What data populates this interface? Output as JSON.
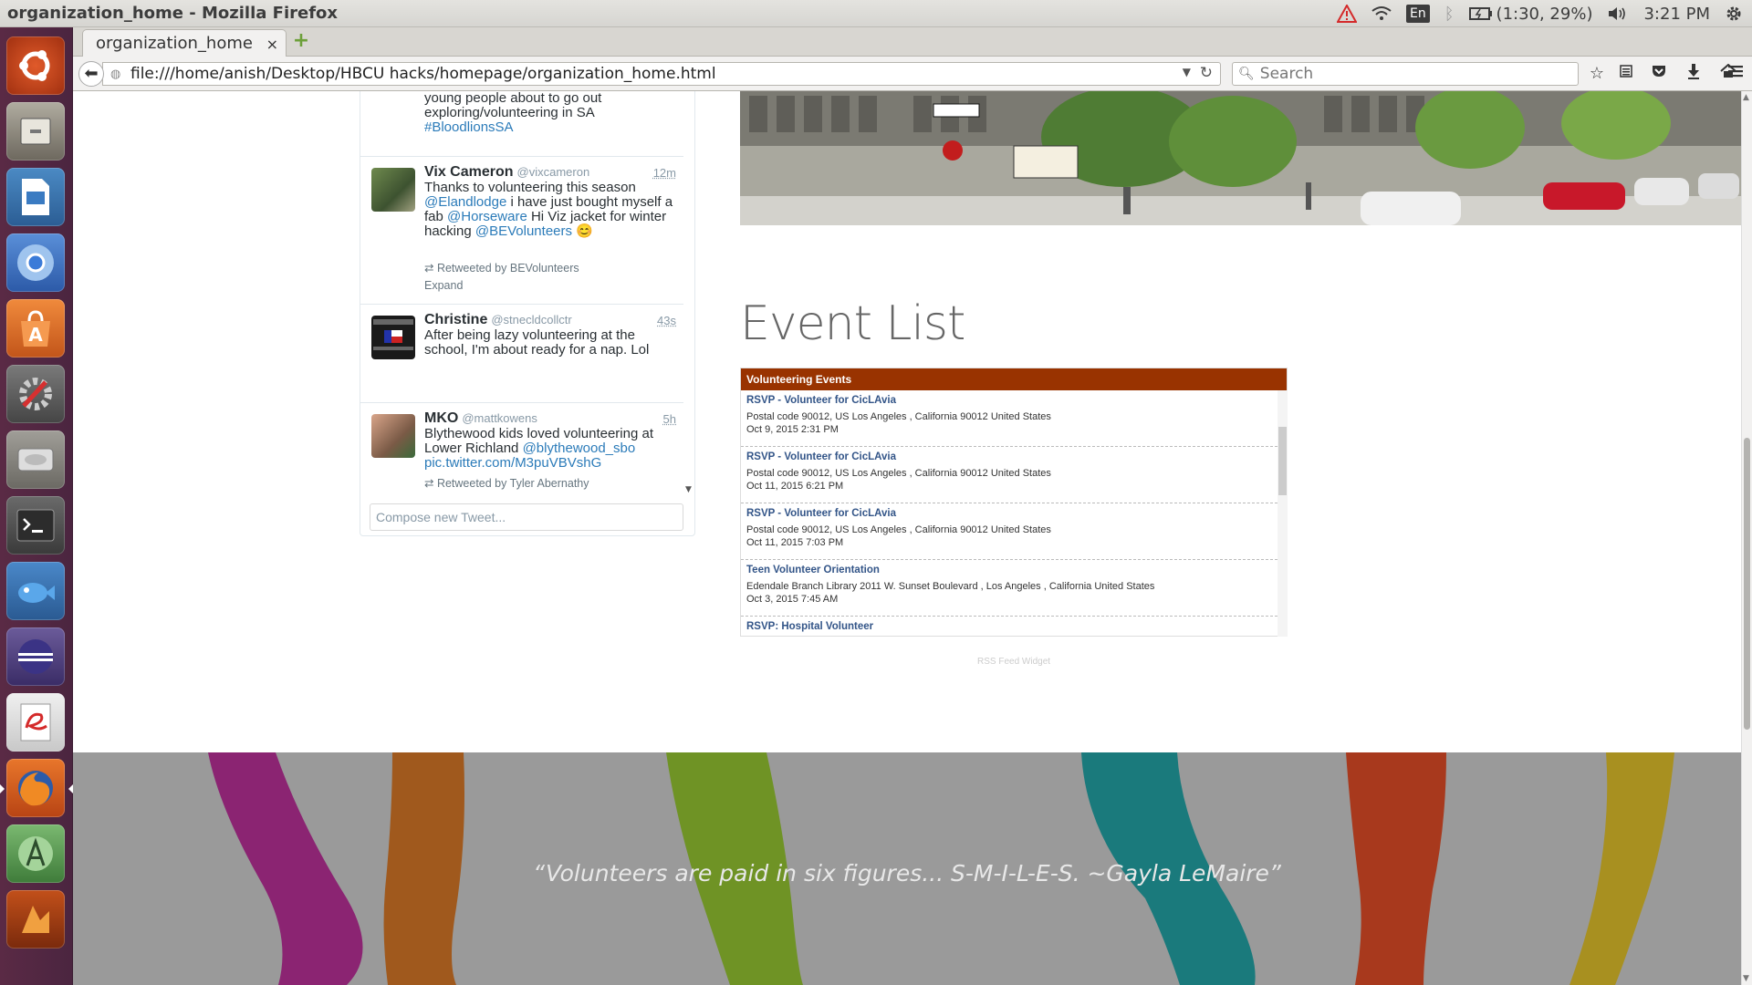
{
  "window": {
    "title": "organization_home - Mozilla Firefox"
  },
  "panel": {
    "battery": "(1:30, 29%)",
    "clock": "3:21 PM",
    "lang": "En"
  },
  "launcher": {
    "items": [
      "Ubuntu dash",
      "Files",
      "LibreOffice Impress",
      "Chromium",
      "Ubuntu Software Center",
      "System Settings",
      "Disk",
      "Terminal",
      "Mail client",
      "Eclipse",
      "Evince",
      "Firefox",
      "Android Studio",
      "Other app"
    ]
  },
  "browser": {
    "tab_title": "organization_home",
    "tab_close": "×",
    "new_tab": "+",
    "url": "file:///home/anish/Desktop/HBCU hacks/homepage/organization_home.html",
    "search_placeholder": "Search"
  },
  "twitter": {
    "tweets": [
      {
        "name": "",
        "handle": "",
        "time": "",
        "text_prefix": "young people about to go out exploring/volunteering in SA",
        "hashtag": "#BloodlionsSA"
      },
      {
        "name": "Vix Cameron",
        "handle": "@vixcameron",
        "time": "12m",
        "text_1": "Thanks to volunteering this season",
        "mention_1": "@Elandlodge",
        "text_2": "i have just bought myself a fab",
        "mention_2": "@Horseware",
        "text_3": "Hi Viz jacket for winter hacking",
        "mention_3": "@BEVolunteers",
        "emoji": "😊",
        "retweeted_by": "Retweeted by BEVolunteers",
        "expand": "Expand"
      },
      {
        "name": "Christine",
        "handle": "@stnecldcollctr",
        "time": "43s",
        "text": "After being lazy volunteering at the school, I'm about ready for a nap. Lol"
      },
      {
        "name": "MKO",
        "handle": "@mattkowens",
        "time": "5h",
        "text_1": "Blythewood kids loved volunteering at Lower Richland",
        "mention_1": "@blythewood_sbo",
        "link": "pic.twitter.com/M3puVBVshG",
        "retweeted_by": "Retweeted by Tyler Abernathy"
      }
    ],
    "compose_placeholder": "Compose new Tweet..."
  },
  "event_list": {
    "title": "Event List",
    "widget_header": "Volunteering Events",
    "items": [
      {
        "title": "RSVP - Volunteer for CicLAvia",
        "location": "Postal code 90012, US Los Angeles , California 90012 United States",
        "date": "Oct 9, 2015 2:31 PM"
      },
      {
        "title": "RSVP - Volunteer for CicLAvia",
        "location": "Postal code 90012, US Los Angeles , California 90012 United States",
        "date": "Oct 11, 2015 6:21 PM"
      },
      {
        "title": "RSVP - Volunteer for CicLAvia",
        "location": "Postal code 90012, US Los Angeles , California 90012 United States",
        "date": "Oct 11, 2015 7:03 PM"
      },
      {
        "title": "Teen Volunteer Orientation",
        "location": "Edendale Branch Library 2011 W. Sunset Boulevard , Los Angeles , California United States",
        "date": "Oct 3, 2015 7:45 AM"
      },
      {
        "title": "RSVP: Hospital Volunteer",
        "location": "",
        "date": ""
      }
    ],
    "credit": "RSS Feed Widget"
  },
  "quote": {
    "text": "“Volunteers are paid in six figures... S-M-I-L-E-S. ~Gayla LeMaire”"
  },
  "colors": {
    "event_header": "#993300",
    "link_blue": "#2b7bb9",
    "stripes": [
      "#8b2472",
      "#a0591d",
      "#6f9325",
      "#1a7a7c",
      "#a8391d",
      "#a89020"
    ]
  }
}
